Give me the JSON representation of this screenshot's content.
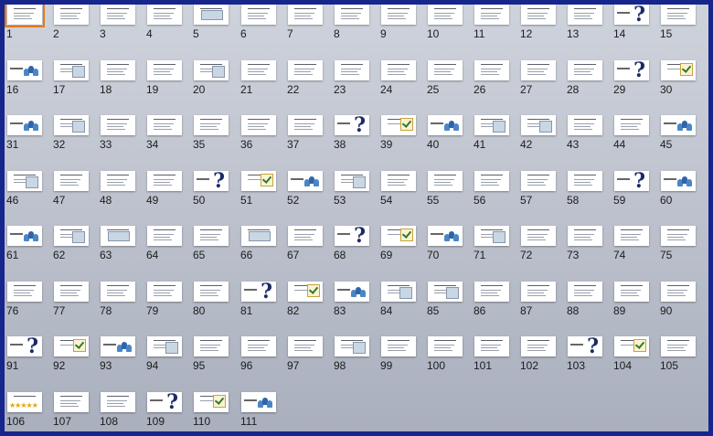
{
  "app": {
    "view": "slide-sorter"
  },
  "selected_slide": "1",
  "slides": [
    {
      "n": "1",
      "kind": "text"
    },
    {
      "n": "2",
      "kind": "text"
    },
    {
      "n": "3",
      "kind": "text"
    },
    {
      "n": "4",
      "kind": "text"
    },
    {
      "n": "5",
      "kind": "chart"
    },
    {
      "n": "6",
      "kind": "text"
    },
    {
      "n": "7",
      "kind": "text"
    },
    {
      "n": "8",
      "kind": "text"
    },
    {
      "n": "9",
      "kind": "text"
    },
    {
      "n": "10",
      "kind": "text"
    },
    {
      "n": "11",
      "kind": "text"
    },
    {
      "n": "12",
      "kind": "text"
    },
    {
      "n": "13",
      "kind": "text"
    },
    {
      "n": "14",
      "kind": "question"
    },
    {
      "n": "15",
      "kind": "text"
    },
    {
      "n": "16",
      "kind": "people"
    },
    {
      "n": "17",
      "kind": "picture"
    },
    {
      "n": "18",
      "kind": "text"
    },
    {
      "n": "19",
      "kind": "text"
    },
    {
      "n": "20",
      "kind": "picture"
    },
    {
      "n": "21",
      "kind": "text"
    },
    {
      "n": "22",
      "kind": "text"
    },
    {
      "n": "23",
      "kind": "text"
    },
    {
      "n": "24",
      "kind": "text"
    },
    {
      "n": "25",
      "kind": "text"
    },
    {
      "n": "26",
      "kind": "text"
    },
    {
      "n": "27",
      "kind": "text"
    },
    {
      "n": "28",
      "kind": "text"
    },
    {
      "n": "29",
      "kind": "question"
    },
    {
      "n": "30",
      "kind": "check"
    },
    {
      "n": "31",
      "kind": "people"
    },
    {
      "n": "32",
      "kind": "picture"
    },
    {
      "n": "33",
      "kind": "text"
    },
    {
      "n": "34",
      "kind": "text"
    },
    {
      "n": "35",
      "kind": "text"
    },
    {
      "n": "36",
      "kind": "text"
    },
    {
      "n": "37",
      "kind": "text"
    },
    {
      "n": "38",
      "kind": "question"
    },
    {
      "n": "39",
      "kind": "check"
    },
    {
      "n": "40",
      "kind": "people"
    },
    {
      "n": "41",
      "kind": "picture"
    },
    {
      "n": "42",
      "kind": "picture"
    },
    {
      "n": "43",
      "kind": "text"
    },
    {
      "n": "44",
      "kind": "text"
    },
    {
      "n": "45",
      "kind": "people"
    },
    {
      "n": "46",
      "kind": "picture"
    },
    {
      "n": "47",
      "kind": "text"
    },
    {
      "n": "48",
      "kind": "text"
    },
    {
      "n": "49",
      "kind": "text"
    },
    {
      "n": "50",
      "kind": "question"
    },
    {
      "n": "51",
      "kind": "check"
    },
    {
      "n": "52",
      "kind": "people"
    },
    {
      "n": "53",
      "kind": "picture"
    },
    {
      "n": "54",
      "kind": "text"
    },
    {
      "n": "55",
      "kind": "text"
    },
    {
      "n": "56",
      "kind": "text"
    },
    {
      "n": "57",
      "kind": "text"
    },
    {
      "n": "58",
      "kind": "text"
    },
    {
      "n": "59",
      "kind": "question"
    },
    {
      "n": "60",
      "kind": "people"
    },
    {
      "n": "61",
      "kind": "people"
    },
    {
      "n": "62",
      "kind": "picture"
    },
    {
      "n": "63",
      "kind": "chart"
    },
    {
      "n": "64",
      "kind": "text"
    },
    {
      "n": "65",
      "kind": "text"
    },
    {
      "n": "66",
      "kind": "chart"
    },
    {
      "n": "67",
      "kind": "text"
    },
    {
      "n": "68",
      "kind": "question"
    },
    {
      "n": "69",
      "kind": "check"
    },
    {
      "n": "70",
      "kind": "people"
    },
    {
      "n": "71",
      "kind": "picture"
    },
    {
      "n": "72",
      "kind": "text"
    },
    {
      "n": "73",
      "kind": "text"
    },
    {
      "n": "74",
      "kind": "text"
    },
    {
      "n": "75",
      "kind": "text"
    },
    {
      "n": "76",
      "kind": "text"
    },
    {
      "n": "77",
      "kind": "text"
    },
    {
      "n": "78",
      "kind": "text"
    },
    {
      "n": "79",
      "kind": "text"
    },
    {
      "n": "80",
      "kind": "text"
    },
    {
      "n": "81",
      "kind": "question"
    },
    {
      "n": "82",
      "kind": "check"
    },
    {
      "n": "83",
      "kind": "people"
    },
    {
      "n": "84",
      "kind": "picture"
    },
    {
      "n": "85",
      "kind": "picture"
    },
    {
      "n": "86",
      "kind": "text"
    },
    {
      "n": "87",
      "kind": "text"
    },
    {
      "n": "88",
      "kind": "text"
    },
    {
      "n": "89",
      "kind": "text"
    },
    {
      "n": "90",
      "kind": "text"
    },
    {
      "n": "91",
      "kind": "question"
    },
    {
      "n": "92",
      "kind": "check"
    },
    {
      "n": "93",
      "kind": "people"
    },
    {
      "n": "94",
      "kind": "picture"
    },
    {
      "n": "95",
      "kind": "text"
    },
    {
      "n": "96",
      "kind": "text"
    },
    {
      "n": "97",
      "kind": "text"
    },
    {
      "n": "98",
      "kind": "picture"
    },
    {
      "n": "99",
      "kind": "text"
    },
    {
      "n": "100",
      "kind": "text"
    },
    {
      "n": "101",
      "kind": "text"
    },
    {
      "n": "102",
      "kind": "text"
    },
    {
      "n": "103",
      "kind": "question"
    },
    {
      "n": "104",
      "kind": "check"
    },
    {
      "n": "105",
      "kind": "text"
    },
    {
      "n": "106",
      "kind": "stars"
    },
    {
      "n": "107",
      "kind": "text"
    },
    {
      "n": "108",
      "kind": "text"
    },
    {
      "n": "109",
      "kind": "question"
    },
    {
      "n": "110",
      "kind": "check"
    },
    {
      "n": "111",
      "kind": "people"
    }
  ],
  "colors": {
    "frame": "#16268c",
    "selection": "#e27a1f",
    "background_top": "#cfd3dc",
    "background_bottom": "#a9afbd"
  }
}
